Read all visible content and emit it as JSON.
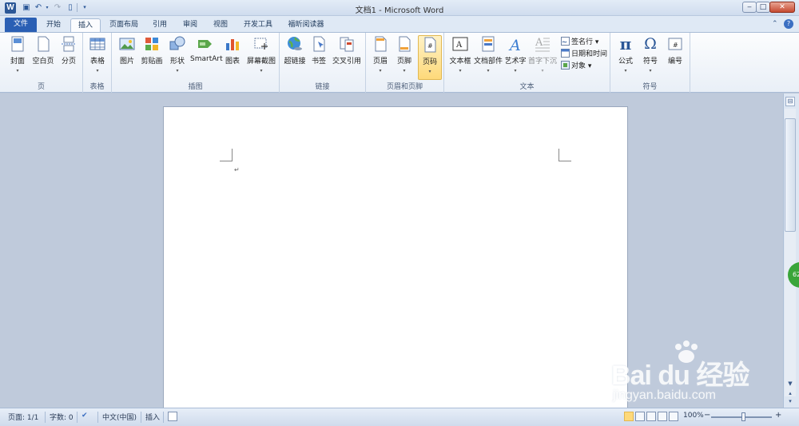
{
  "window": {
    "app_icon": "W",
    "title": "文档1  -  Microsoft Word",
    "min": "‒",
    "max": "□",
    "close": "✕"
  },
  "quick_access": {
    "save_icon": "save-icon",
    "undo_icon": "undo-icon",
    "redo_icon": "redo-icon",
    "new_icon": "new-doc-icon"
  },
  "tabs": [
    "文件",
    "开始",
    "插入",
    "页面布局",
    "引用",
    "审阅",
    "视图",
    "开发工具",
    "福昕阅读器"
  ],
  "active_tab": "插入",
  "ribbon": {
    "groups": {
      "page": "页",
      "table": "表格",
      "illustrations": "插图",
      "links": "链接",
      "header_footer": "页眉和页脚",
      "text": "文本",
      "symbols": "符号"
    },
    "buttons": {
      "cover": "封面",
      "blank_page": "空白页",
      "page_break": "分页",
      "table": "表格",
      "picture": "图片",
      "clip_art": "剪贴画",
      "shapes": "形状",
      "smartart": "SmartArt",
      "chart": "图表",
      "screenshot": "屏幕截图",
      "hyperlink": "超链接",
      "bookmark": "书签",
      "cross_ref": "交叉引用",
      "header": "页眉",
      "footer": "页脚",
      "page_number": "页码",
      "text_box": "文本框",
      "quick_parts": "文档部件",
      "wordart": "艺术字",
      "drop_cap": "首字下沉",
      "signature_line": "签名行",
      "date_time": "日期和时间",
      "object": "对象",
      "equation": "公式",
      "symbol": "符号",
      "numbering": "编号"
    },
    "glyphs": {
      "pi": "π",
      "omega": "Ω",
      "hash": "#"
    }
  },
  "document": {
    "para_mark": "↵"
  },
  "sidebar": {
    "badge": "62"
  },
  "watermark": {
    "brand": "Bai du 经验",
    "url": "jingyan.baidu.com"
  },
  "status": {
    "page": "页面: 1/1",
    "words": "字数: 0",
    "language": "中文(中国)",
    "mode": "插入",
    "zoom": "100%",
    "zoom_minus": "−",
    "zoom_plus": "+"
  }
}
